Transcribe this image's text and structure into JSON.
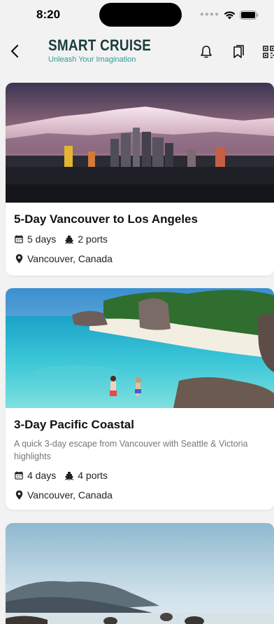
{
  "status_bar": {
    "time": "8:20"
  },
  "header": {
    "brand_title": "SMART CRUISE",
    "brand_tagline": "Unleash Your Imagination"
  },
  "cruises": [
    {
      "title": "5-Day Vancouver to Los Angeles",
      "days": "5 days",
      "ports": "2 ports",
      "location": "Vancouver, Canada"
    },
    {
      "title": "3-Day Pacific Coastal",
      "description": "A quick 3-day escape from Vancouver with Seattle & Victoria highlights",
      "days": "4 days",
      "ports": "4 ports",
      "location": "Vancouver, Canada"
    }
  ],
  "colors": {
    "brand_dark": "#1b3d3b",
    "brand_accent": "#2f9c93",
    "background": "#f2f2f2"
  }
}
